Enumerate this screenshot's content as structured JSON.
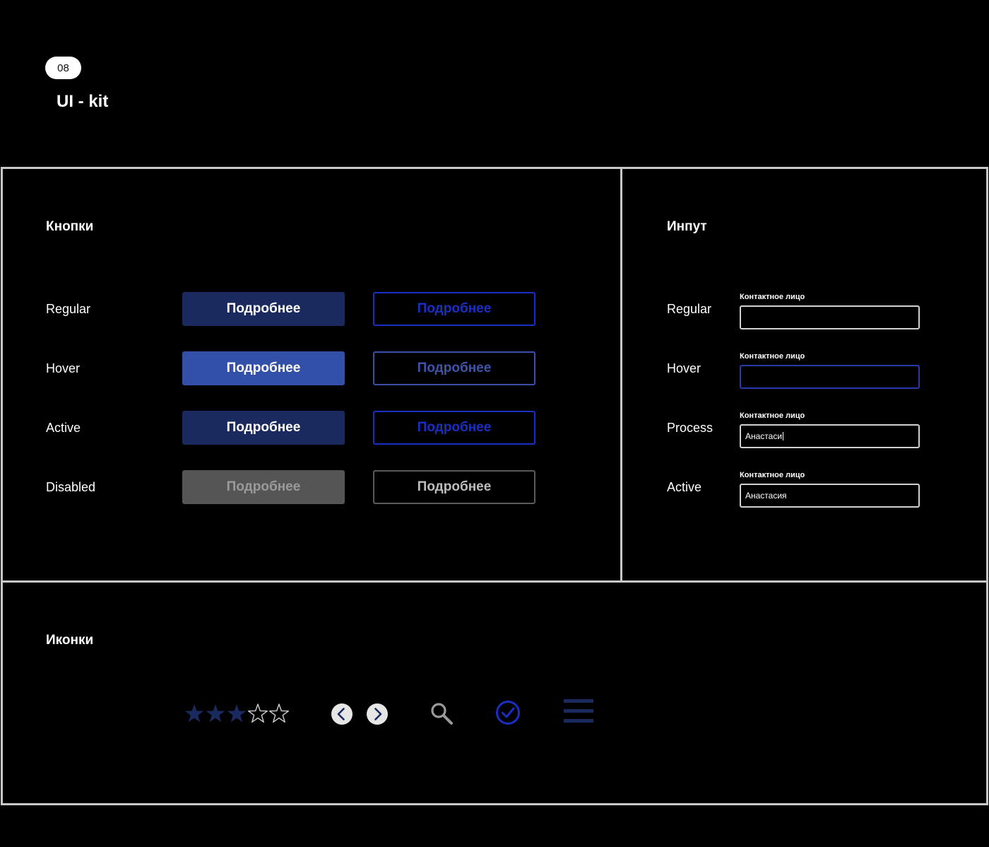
{
  "header": {
    "badge": "08",
    "title": "UI - kit"
  },
  "buttons_panel": {
    "title": "Кнопки",
    "rows": [
      {
        "state": "Regular",
        "label": "Подробнее",
        "filled_bg": "#1b2a5e",
        "outline_color": "#1a2ec4",
        "outline_text": "#1a2ec4"
      },
      {
        "state": "Hover",
        "label": "Подробнее",
        "filled_bg": "#3350a8",
        "outline_color": "#3a4fa8",
        "outline_text": "#3f54a8"
      },
      {
        "state": "Active",
        "label": "Подробнее",
        "filled_bg": "#1b2a5e",
        "outline_color": "#1a2ec4",
        "outline_text": "#1a2ec4"
      },
      {
        "state": "Disabled",
        "label": "Подробнее",
        "filled_bg": "#555555",
        "filled_text": "#9a9a9a",
        "outline_color": "#5a5a5a",
        "outline_text": "#bdbdbd"
      }
    ]
  },
  "inputs_panel": {
    "title": "Инпут",
    "rows": [
      {
        "state": "Regular",
        "label": "Контактное лицо",
        "value": "",
        "border": "#d0d0d0"
      },
      {
        "state": "Hover",
        "label": "Контактное лицо",
        "value": "",
        "border": "#2a3aa8"
      },
      {
        "state": "Process",
        "label": "Контактное лицо",
        "value": "Анастаси",
        "border": "#d0d0d0"
      },
      {
        "state": "Active",
        "label": "Контактное лицо",
        "value": "Анастасия",
        "border": "#d0d0d0"
      }
    ]
  },
  "icons_panel": {
    "title": "Иконки",
    "rating": {
      "filled": 3,
      "total": 5,
      "filled_color": "#1b2a5e",
      "empty_color": "#d0d0d0"
    },
    "icons": [
      "star-icon",
      "chevron-left-icon",
      "chevron-right-icon",
      "search-icon",
      "check-circle-icon",
      "menu-icon"
    ],
    "accent": "#1a2ec4"
  }
}
